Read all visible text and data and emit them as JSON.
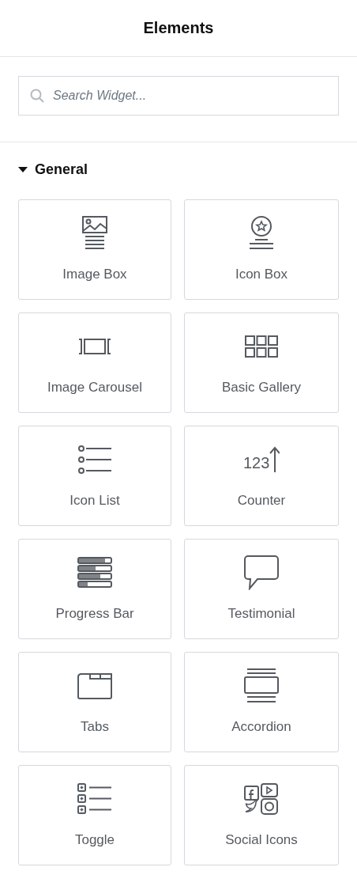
{
  "header": {
    "title": "Elements"
  },
  "counter_icon": {
    "text": "123"
  },
  "search": {
    "placeholder": "Search Widget..."
  },
  "category": {
    "title": "General",
    "expanded": true,
    "widgets": [
      {
        "label": "Image Box",
        "kind": "imagebox"
      },
      {
        "label": "Icon Box",
        "kind": "iconbox"
      },
      {
        "label": "Image Carousel",
        "kind": "carousel"
      },
      {
        "label": "Basic Gallery",
        "kind": "gallery"
      },
      {
        "label": "Icon List",
        "kind": "list"
      },
      {
        "label": "Counter",
        "kind": "counter"
      },
      {
        "label": "Progress Bar",
        "kind": "progress"
      },
      {
        "label": "Testimonial",
        "kind": "testimonial"
      },
      {
        "label": "Tabs",
        "kind": "tabs"
      },
      {
        "label": "Accordion",
        "kind": "accordion"
      },
      {
        "label": "Toggle",
        "kind": "toggle"
      },
      {
        "label": "Social Icons",
        "kind": "social"
      }
    ]
  }
}
